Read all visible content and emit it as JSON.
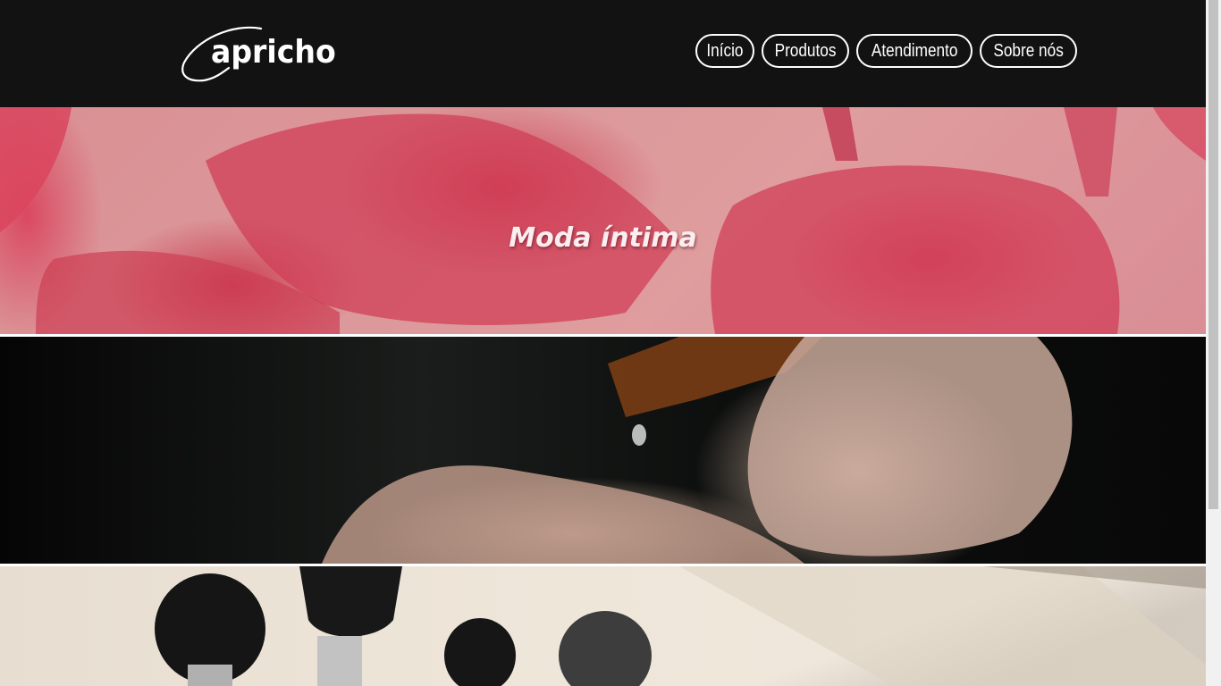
{
  "header": {
    "logo_text": "apricho",
    "nav": [
      {
        "label": "Início"
      },
      {
        "label": "Produtos"
      },
      {
        "label": "Atendimento"
      },
      {
        "label": "Sobre nós"
      }
    ]
  },
  "banners": [
    {
      "title": "Moda íntima",
      "image": "lingerie-photo"
    },
    {
      "image": "essential-oil-photo"
    },
    {
      "image": "makeup-brushes-photo"
    }
  ],
  "colors": {
    "header_bg": "#121212",
    "banner_overlay": "#dc5064"
  }
}
